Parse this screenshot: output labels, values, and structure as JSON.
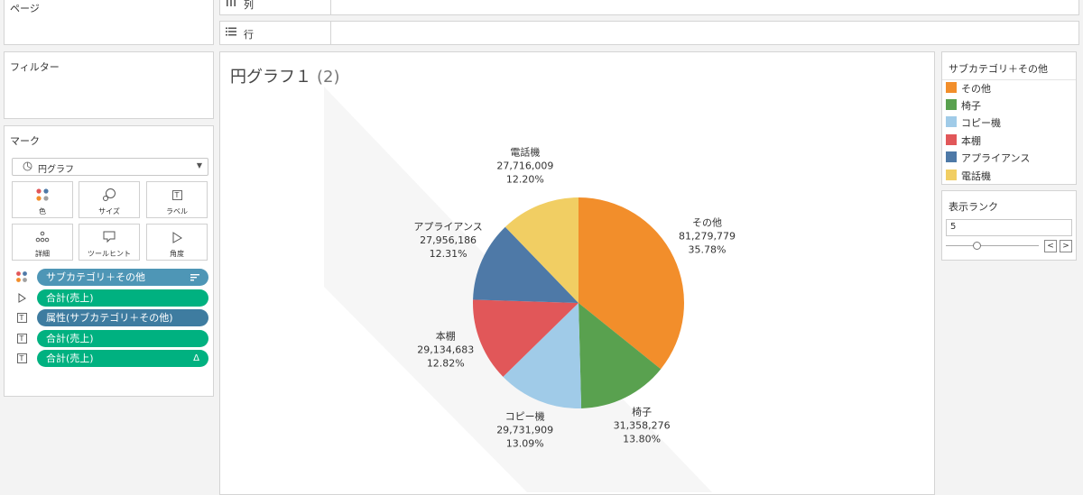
{
  "panels": {
    "pages": "ページ",
    "filters": "フィルター",
    "marks": "マーク"
  },
  "shelves": {
    "columns": {
      "icon": "columns-icon",
      "label": "列"
    },
    "rows": {
      "icon": "rows-icon",
      "label": "行"
    }
  },
  "marks": {
    "type": "円グラフ",
    "buttons": [
      {
        "label": "色",
        "icon": "color-icon"
      },
      {
        "label": "サイズ",
        "icon": "size-icon"
      },
      {
        "label": "ラベル",
        "icon": "label-icon"
      },
      {
        "label": "詳細",
        "icon": "detail-icon"
      },
      {
        "label": "ツールヒント",
        "icon": "tooltip-icon"
      },
      {
        "label": "角度",
        "icon": "angle-icon"
      }
    ],
    "pills": [
      {
        "label": "サブカテゴリ＋その他",
        "icon": "color-icon",
        "color": "#4e96b6"
      },
      {
        "label": "合計(売上)",
        "icon": "angle-icon",
        "color": "#00b180"
      },
      {
        "label": "属性(サブカテゴリ＋その他)",
        "icon": "label-icon",
        "color": "#3e7ca0"
      },
      {
        "label": "合計(売上)",
        "icon": "label-icon",
        "color": "#00b180"
      },
      {
        "label": "合計(売上)",
        "icon": "label-icon",
        "color": "#00b180",
        "trail": "Δ"
      }
    ]
  },
  "viz": {
    "title": "円グラフ１",
    "subtitle": "(2)"
  },
  "legend": {
    "title": "サブカテゴリ＋その他",
    "items": [
      {
        "label": "その他",
        "color": "#f28e2b"
      },
      {
        "label": "椅子",
        "color": "#59a14f"
      },
      {
        "label": "コピー機",
        "color": "#a0cbe8"
      },
      {
        "label": "本棚",
        "color": "#e15759"
      },
      {
        "label": "アプライアンス",
        "color": "#4e79a7"
      },
      {
        "label": "電話機",
        "color": "#f1ce63"
      }
    ]
  },
  "rank": {
    "title": "表示ランク",
    "value": "5",
    "prev": "<",
    "next": ">"
  },
  "chart_data": {
    "type": "pie",
    "categories": [
      "その他",
      "椅子",
      "コピー機",
      "本棚",
      "アプライアンス",
      "電話機"
    ],
    "values": [
      81279779,
      31358276,
      29731909,
      29134683,
      27956186,
      27716009
    ],
    "value_labels": [
      "81,279,779",
      "31,358,276",
      "29,731,909",
      "29,134,683",
      "27,956,186",
      "27,716,009"
    ],
    "percent_labels": [
      "35.78%",
      "13.80%",
      "13.09%",
      "12.82%",
      "12.31%",
      "12.20%"
    ],
    "colors": [
      "#f28e2b",
      "#59a14f",
      "#a0cbe8",
      "#e15759",
      "#4e79a7",
      "#f1ce63"
    ],
    "start": "12 o'clock",
    "direction": "clockwise"
  }
}
